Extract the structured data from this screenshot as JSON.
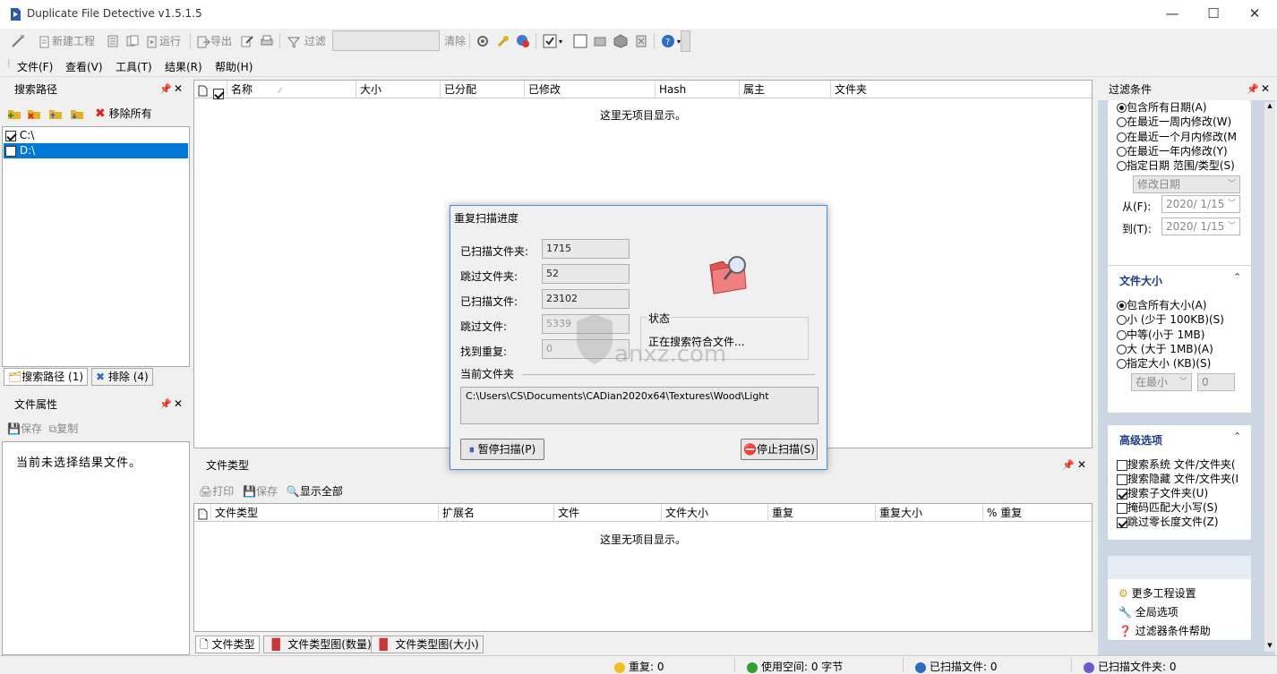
{
  "window": {
    "title": "Duplicate File Detective v1.5.1.5",
    "min": "—",
    "max": "☐",
    "close": "✕"
  },
  "toolbar": {
    "new_project": "新建工程",
    "run": "运行",
    "export": "导出",
    "filter": "过滤",
    "clear": "清除"
  },
  "menu": [
    "文件(F)",
    "查看(V)",
    "工具(T)",
    "结果(R)",
    "帮助(H)"
  ],
  "search_paths": {
    "title": "搜索路径",
    "remove_all": "移除所有",
    "items": [
      {
        "label": "C:\\",
        "checked": true
      },
      {
        "label": "D:\\",
        "checked": false
      }
    ],
    "tab_paths": "搜索路径 (1)",
    "tab_exclude": "排除 (4)"
  },
  "file_props": {
    "title": "文件属性",
    "save": "保存",
    "copy": "复制",
    "empty": "当前未选择结果文件。"
  },
  "results": {
    "columns": [
      "名称",
      "大小",
      "已分配",
      "已修改",
      "Hash",
      "属主",
      "文件夹"
    ],
    "empty": "这里无项目显示。"
  },
  "filetypes": {
    "title": "文件类型",
    "print": "打印",
    "save": "保存",
    "show_all": "显示全部",
    "columns": [
      "文件类型",
      "扩展名",
      "文件",
      "文件大小",
      "重复",
      "重复大小",
      "% 重复"
    ],
    "empty": "这里无项目显示。",
    "tabs": [
      "文件类型",
      "文件类型图(数量)",
      "文件类型图(大小)"
    ]
  },
  "dialog": {
    "title": "重复扫描进度",
    "scanned_folders_label": "已扫描文件夹:",
    "scanned_folders": "1715",
    "skipped_folders_label": "跳过文件夹:",
    "skipped_folders": "52",
    "scanned_files_label": "已扫描文件:",
    "scanned_files": "23102",
    "skipped_files_label": "跳过文件:",
    "skipped_files": "5339",
    "dups_label": "找到重复:",
    "dups": "0",
    "status_label": "状态",
    "status_text": "正在搜索符合文件...",
    "current_folder_label": "当前文件夹",
    "current_folder": "C:\\Users\\CS\\Documents\\CADian2020x64\\Textures\\Wood\\Light",
    "pause": "暂停扫描(P)",
    "stop": "停止扫描(S)"
  },
  "filter": {
    "title": "过滤条件",
    "date_options": [
      "包含所有日期(A)",
      "在最近一周内修改(W)",
      "在最近一个月内修改(M",
      "在最近一年内修改(Y)",
      "指定日期 范围/类型(S)"
    ],
    "date_type": "修改日期",
    "from_label": "从(F):",
    "from": "2020/ 1/15",
    "to_label": "到(T):",
    "to": "2020/ 1/15",
    "size_title": "文件大小",
    "size_options": [
      "包含所有大小(A)",
      "小 (少于 100KB)(S)",
      "中等(小于 1MB)",
      "大 (大于 1MB)(A)",
      "指定大小 (KB)(S)"
    ],
    "size_unit": "在最小",
    "size_value": "0",
    "adv_title": "高级选项",
    "adv_options": [
      {
        "label": "搜索系统 文件/文件夹(",
        "checked": false
      },
      {
        "label": "搜索隐藏 文件/文件夹(I",
        "checked": false
      },
      {
        "label": "搜索子文件夹(U)",
        "checked": true
      },
      {
        "label": "掩码匹配大小写(S)",
        "checked": false
      },
      {
        "label": "跳过零长度文件(Z)",
        "checked": true
      }
    ],
    "links": [
      "更多工程设置",
      "全局选项",
      "过滤器条件帮助"
    ]
  },
  "statusbar": {
    "dups": "重复: 0",
    "space": "使用空间: 0 字节",
    "files": "已扫描文件: 0",
    "folders": "已扫描文件夹: 0"
  },
  "watermark": "anxz.com",
  "colors": {
    "accent": "#0078d7",
    "header_blue": "#1e3a8a",
    "stop_red": "#d9322e"
  }
}
